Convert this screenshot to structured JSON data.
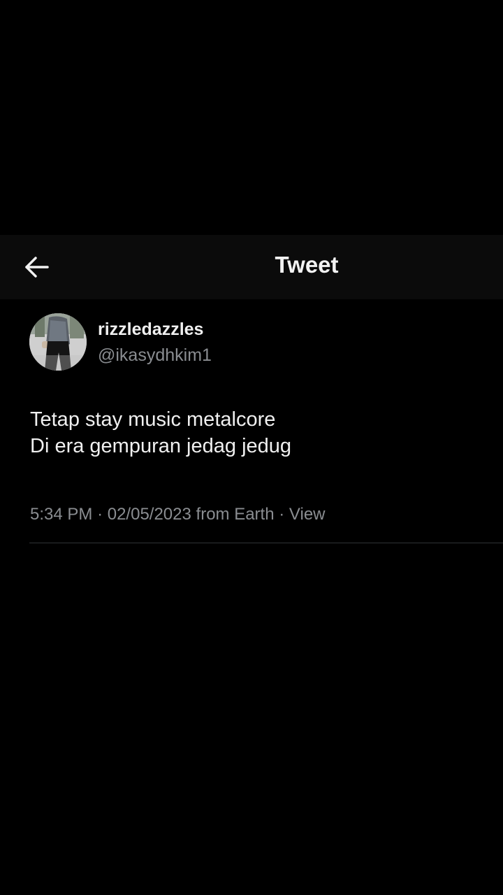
{
  "header": {
    "back_icon": "arrow-left-icon",
    "title": "Tweet"
  },
  "tweet": {
    "author": {
      "display_name": "rizzledazzles",
      "handle": "@ikasydhkim1",
      "avatar_icon": "profile-photo"
    },
    "text_lines": [
      "Tetap stay music metalcore",
      "Di era gempuran jedag jedug"
    ],
    "meta": {
      "time": "5:34 PM",
      "separator": "·",
      "date": "02/05/2023",
      "source": "from Earth",
      "view_label": "View"
    }
  },
  "colors": {
    "background": "#000000",
    "header_background": "#0b0b0b",
    "primary_text": "#f0f0f0",
    "secondary_text": "#8a8d91",
    "divider": "#2f3336"
  }
}
